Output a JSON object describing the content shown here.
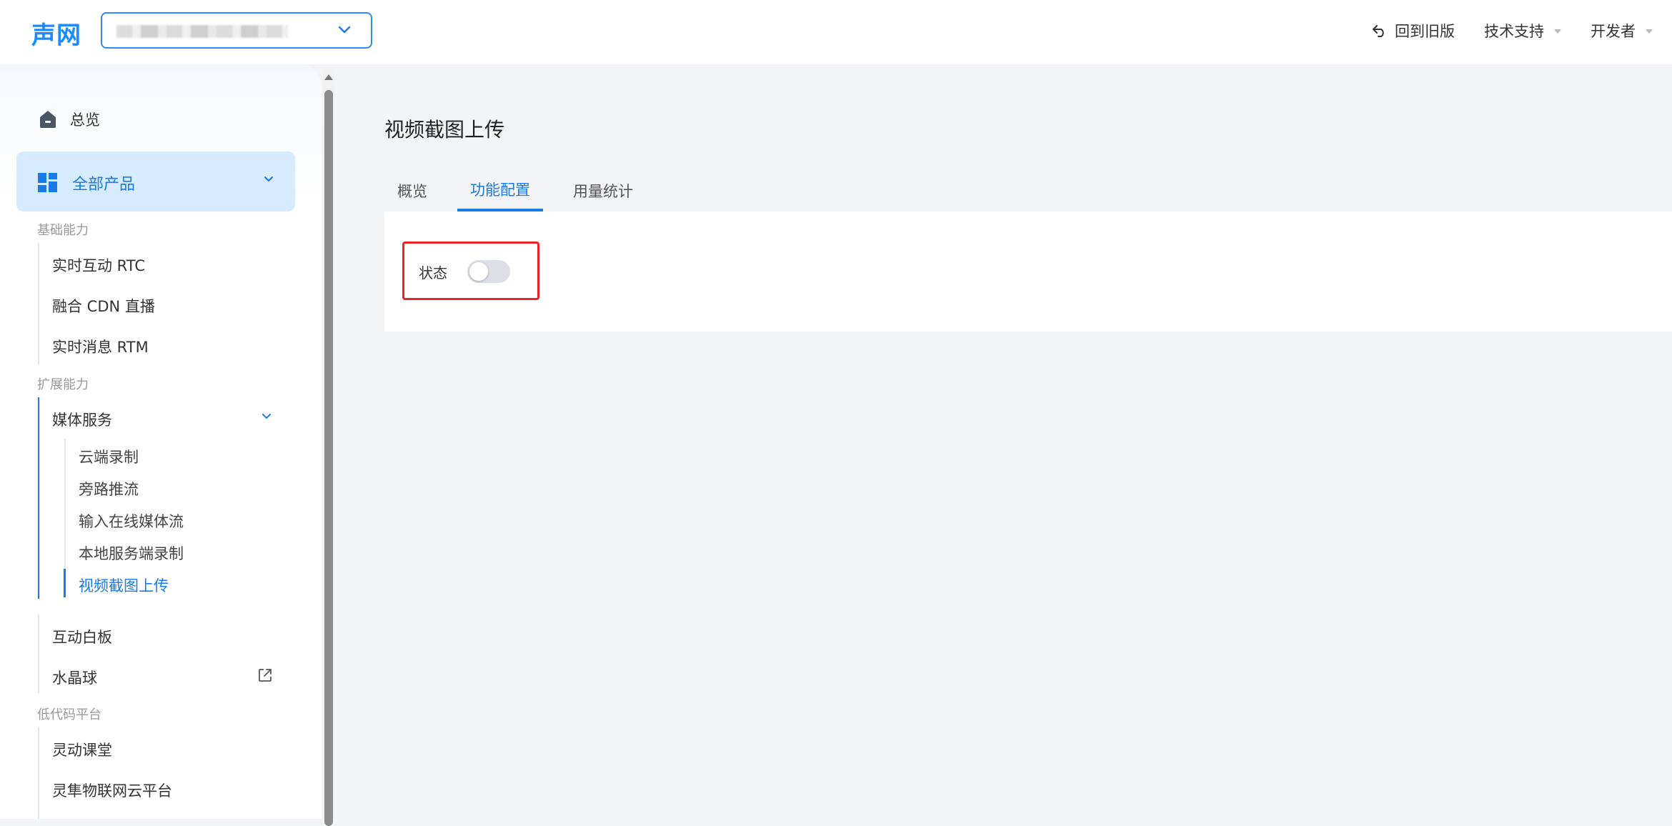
{
  "header": {
    "logo_text": "声网",
    "project_select": {
      "chevron_icon": "chevron-down-icon"
    },
    "back_to_old_label": "回到旧版",
    "back_icon": "undo-arrow-icon",
    "tech_support_label": "技术支持",
    "developer_label": "开发者"
  },
  "sidebar": {
    "overview_label": "总览",
    "overview_icon": "home-icon",
    "all_products_label": "全部产品",
    "all_products_icon": "grid-icon",
    "sections": {
      "basic": "基础能力",
      "extended": "扩展能力",
      "lowcode": "低代码平台"
    },
    "basic_items": [
      "实时互动 RTC",
      "融合 CDN 直播",
      "实时消息 RTM"
    ],
    "media_service_label": "媒体服务",
    "media_sub_items": [
      "云端录制",
      "旁路推流",
      "输入在线媒体流",
      "本地服务端录制",
      "视频截图上传"
    ],
    "extended_items": [
      "互动白板",
      "水晶球"
    ],
    "external_link_icon": "external-link-icon",
    "lowcode_items": [
      "灵动课堂",
      "灵隼物联网云平台"
    ]
  },
  "main": {
    "title": "视频截图上传",
    "tabs": [
      "概览",
      "功能配置",
      "用量统计"
    ],
    "active_tab": "功能配置",
    "status_label": "状态",
    "status_enabled": false
  },
  "colors": {
    "accent": "#1a7be8",
    "highlight_border": "#e8242a",
    "page_bg": "#f2f4f8"
  }
}
